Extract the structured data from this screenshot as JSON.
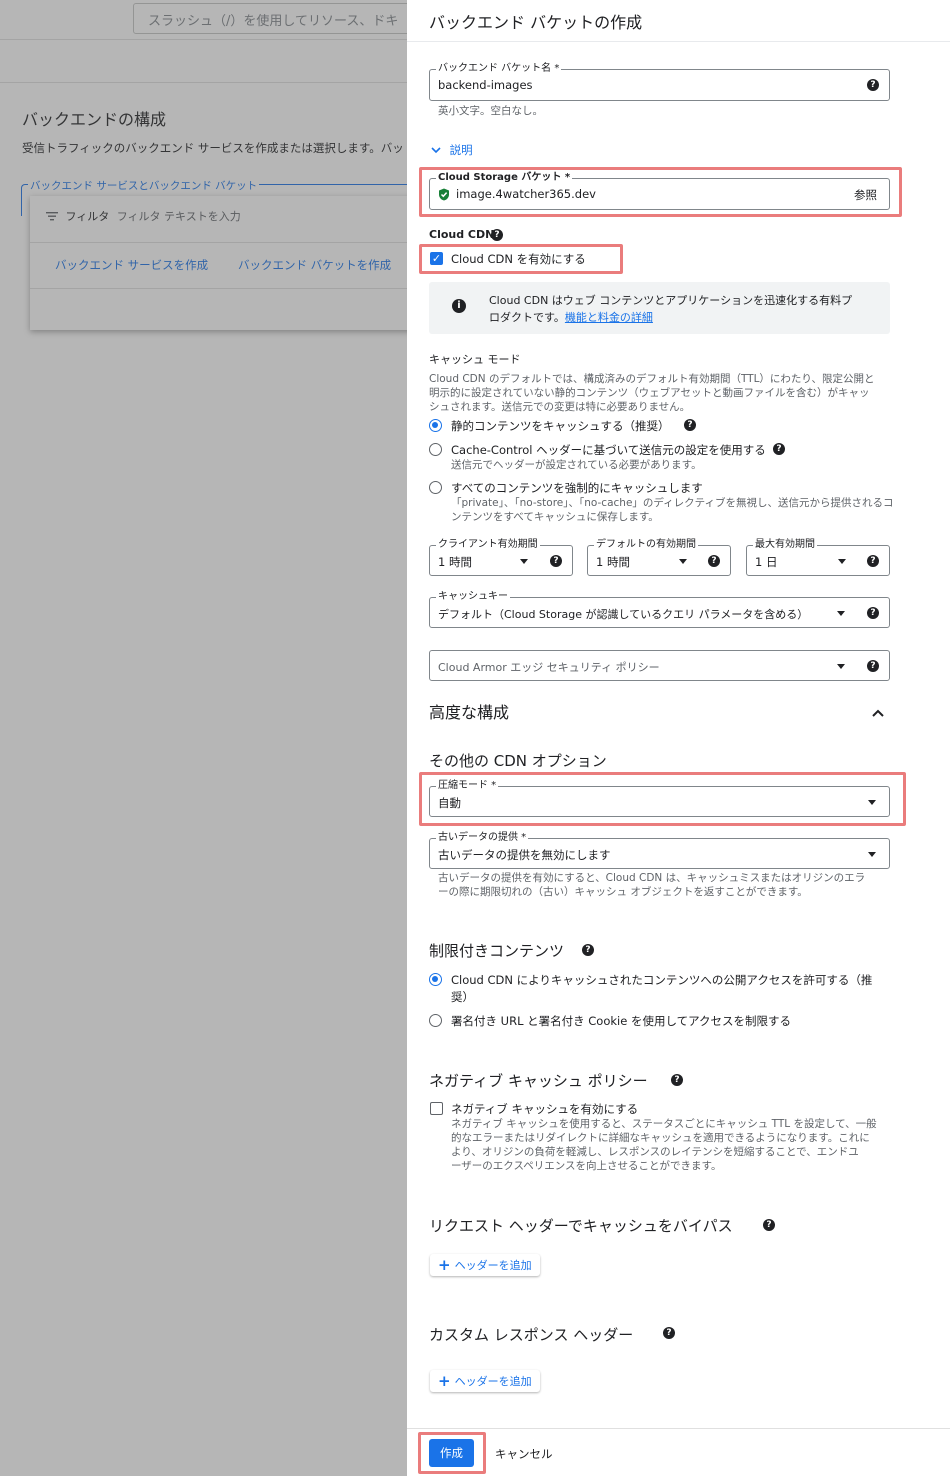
{
  "background": {
    "search_placeholder": "スラッシュ（/）を使用してリソース、ドキ",
    "title": "バックエンドの構成",
    "description": "受信トラフィックのバックエンド サービスを作成または選択します。バッ",
    "fieldset_legend": "バックエンド サービスとバックエンド バケット",
    "menu": {
      "filter_label": "フィルタ",
      "filter_placeholder": "フィルタ テキストを入力",
      "create_service": "バックエンド サービスを作成",
      "create_bucket": "バックエンド バケットを作成"
    }
  },
  "panel": {
    "title": "バックエンド バケットの作成",
    "bucket_name": {
      "label": "バックエンド バケット名 *",
      "value": "backend-images",
      "hint": "英小文字。空白なし。"
    },
    "description_toggle": "説明",
    "storage": {
      "label": "Cloud Storage バケット *",
      "value": "image.4watcher365.dev",
      "browse": "参照"
    },
    "cdn": {
      "section_label": "Cloud CDN",
      "enable_label": "Cloud CDN を有効にする",
      "enabled": true,
      "info_text": "Cloud CDN はウェブ コンテンツとアプリケーションを迅速化する有料プ",
      "info_text2": "ロダクトです。",
      "info_link": "機能と料金の詳細"
    },
    "cache_mode": {
      "title": "キャッシュ モード",
      "desc1": "Cloud CDN のデフォルトでは、構成済みのデフォルト有効期間（TTL）にわたり、限定公開と",
      "desc2": "明示的に設定されていない静的コンテンツ（ウェブアセットと動画ファイルを含む）がキャッ",
      "desc3": "シュされます。送信元での変更は特に必要ありません。",
      "options": [
        {
          "label": "静的コンテンツをキャッシュする（推奨）",
          "selected": true
        },
        {
          "label": "Cache-Control ヘッダーに基づいて送信元の設定を使用する",
          "sub": "送信元でヘッダーが設定されている必要があります。",
          "selected": false
        },
        {
          "label": "すべてのコンテンツを強制的にキャッシュします",
          "sub": "「private」、「no-store」、「no-cache」のディレクティブを無視し、送信元から提供されるコ",
          "sub2": "ンテンツをすべてキャッシュに保存します。",
          "selected": false
        }
      ]
    },
    "ttl": {
      "client": {
        "label": "クライアント有効期間",
        "value": "1 時間"
      },
      "default": {
        "label": "デフォルトの有効期間",
        "value": "1 時間"
      },
      "max": {
        "label": "最大有効期間",
        "value": "1 日"
      }
    },
    "cache_key": {
      "label": "キャッシュキー",
      "value": "デフォルト（Cloud Storage が認識しているクエリ パラメータを含める）"
    },
    "armor": {
      "placeholder": "Cloud Armor エッジ セキュリティ ポリシー"
    },
    "advanced": {
      "title": "高度な構成",
      "other_cdn_title": "その他の CDN オプション",
      "compression": {
        "label": "圧縮モード *",
        "value": "自動"
      },
      "stale": {
        "label": "古いデータの提供 *",
        "value": "古いデータの提供を無効にします",
        "hint1": "古いデータの提供を有効にすると、Cloud CDN は、キャッシュミスまたはオリジンのエラ",
        "hint2": "ーの際に期限切れの（古い）キャッシュ オブジェクトを返すことができます。"
      }
    },
    "restricted": {
      "title": "制限付きコンテンツ",
      "option1": "Cloud CDN によりキャッシュされたコンテンツへの公開アクセスを許可する（推",
      "option1b": "奨）",
      "option2": "署名付き URL と署名付き Cookie を使用してアクセスを制限する"
    },
    "negative_cache": {
      "title": "ネガティブ キャッシュ ポリシー",
      "enable_label": "ネガティブ キャッシュを有効にする",
      "desc1": "ネガティブ キャッシュを使用すると、ステータスごとにキャッシュ TTL を設定して、一般",
      "desc2": "的なエラーまたはリダイレクトに詳細なキャッシュを適用できるようになります。これに",
      "desc3": "より、オリジンの負荷を軽減し、レスポンスのレイテンシを短縮することで、エンドユ",
      "desc4": "ーザーのエクスペリエンスを向上させることができます。"
    },
    "bypass": {
      "title": "リクエスト ヘッダーでキャッシュをバイパス",
      "add_button": "ヘッダーを追加"
    },
    "custom_headers": {
      "title": "カスタム レスポンス ヘッダー",
      "add_button": "ヘッダーを追加"
    },
    "footer": {
      "create": "作成",
      "cancel": "キャンセル"
    }
  },
  "colors": {
    "accent": "#1a73e8",
    "highlight": "#ea7c7c"
  }
}
